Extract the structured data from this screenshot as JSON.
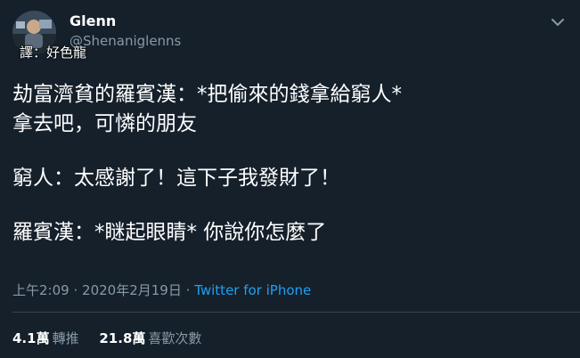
{
  "tweet": {
    "display_name": "Glenn",
    "handle": "@Shenaniglenns",
    "translator_note": "譯：好色龍",
    "body": {
      "line1": "劫富濟貧的羅賓漢：*把偷來的錢拿給窮人*",
      "line2": "拿去吧，可憐的朋友",
      "line3": "窮人：太感謝了！這下子我發財了！",
      "line4": "羅賓漢：*瞇起眼睛* 你說你怎麼了"
    },
    "time": "上午2:09",
    "separator": "·",
    "date": "2020年2月19日",
    "source": "Twitter for iPhone",
    "stats": {
      "retweets_count": "4.1萬",
      "retweets_label": "轉推",
      "likes_count": "21.8萬",
      "likes_label": "喜歡次數"
    }
  },
  "colors": {
    "background": "#15202b",
    "text": "#ffffff",
    "secondary": "#8899a6",
    "link": "#1da1f2",
    "divider": "#38444d"
  },
  "icons": {
    "more": "chevron-down-icon"
  }
}
